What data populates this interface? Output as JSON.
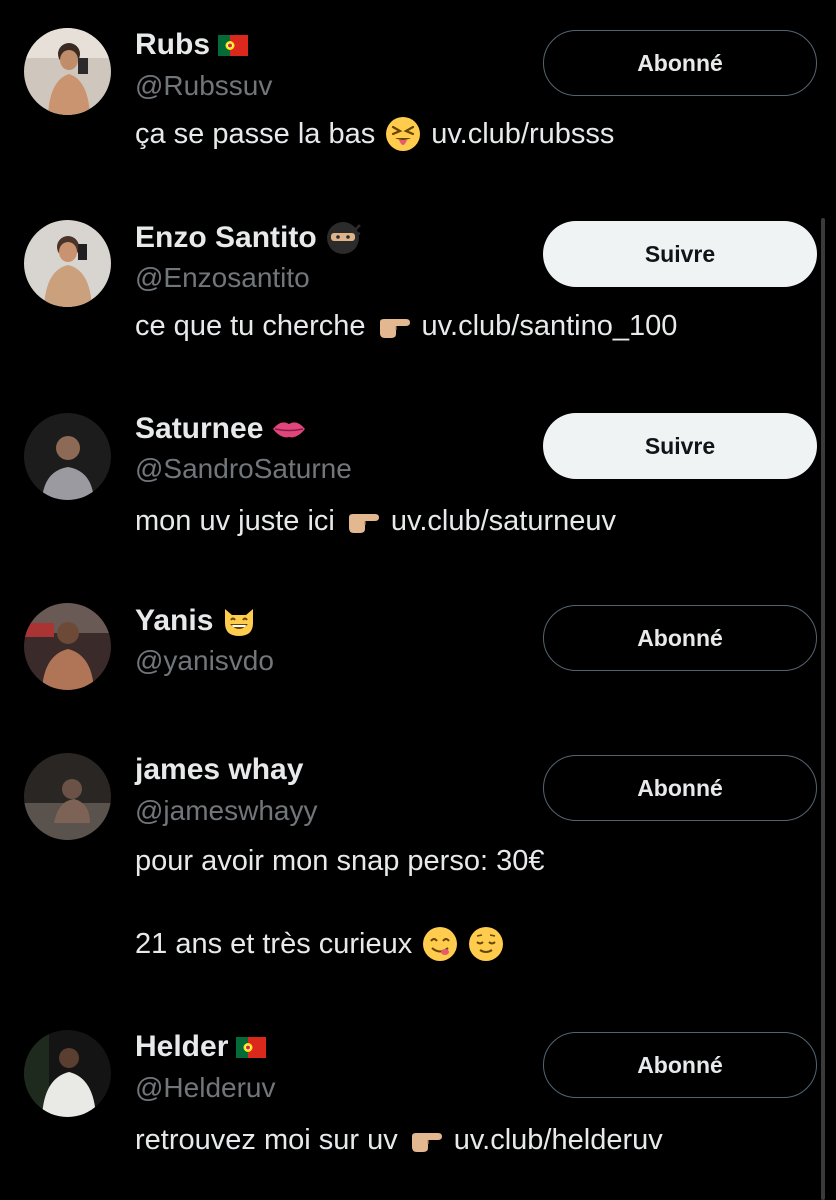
{
  "users": [
    {
      "name": "Rubs",
      "name_badge": "portugal-flag-icon",
      "handle": "@Rubssuv",
      "button": "Abonné",
      "bio_lines": [
        {
          "text": "ça se passe la bas",
          "emoji": "squinting-tongue-emoji",
          "link": "uv.club/rubsss"
        }
      ]
    },
    {
      "name": "Enzo Santito",
      "name_badge": "ninja-emoji",
      "handle": "@Enzosantito",
      "button": "Suivre",
      "bio_lines": [
        {
          "text": "ce que tu cherche",
          "emoji": "pointing-right-emoji",
          "link": "uv.club/santino_100"
        }
      ]
    },
    {
      "name": "Saturnee",
      "name_badge": "lips-emoji",
      "handle": "@SandroSaturne",
      "button": "Suivre",
      "bio_lines": [
        {
          "text": "mon uv juste ici",
          "emoji": "pointing-right-emoji",
          "link": "uv.club/saturneuv"
        }
      ]
    },
    {
      "name": "Yanis",
      "name_badge": "grinning-cat-emoji",
      "handle": "@yanisvdo",
      "button": "Abonné",
      "bio_lines": []
    },
    {
      "name": "james whay",
      "name_badge": "",
      "handle": "@jameswhayy",
      "button": "Abonné",
      "bio_lines": [
        {
          "text": "pour avoir mon snap perso: 30€",
          "emoji": "",
          "link": ""
        },
        {
          "text": "21 ans et très curieux",
          "emoji": "yum-relieved-emoji",
          "link": ""
        }
      ]
    },
    {
      "name": "Helder",
      "name_badge": "portugal-flag-icon",
      "handle": "@Helderuv",
      "button": "Abonné",
      "bio_lines": [
        {
          "text": "retrouvez moi sur uv",
          "emoji": "pointing-right-emoji",
          "link": "uv.club/helderuv"
        }
      ]
    }
  ],
  "colors": {
    "background": "#000000",
    "primary_text": "#e7e9ea",
    "secondary_text": "#71767b",
    "follow_button_bg": "#eff3f4",
    "following_button_border": "#536471"
  }
}
